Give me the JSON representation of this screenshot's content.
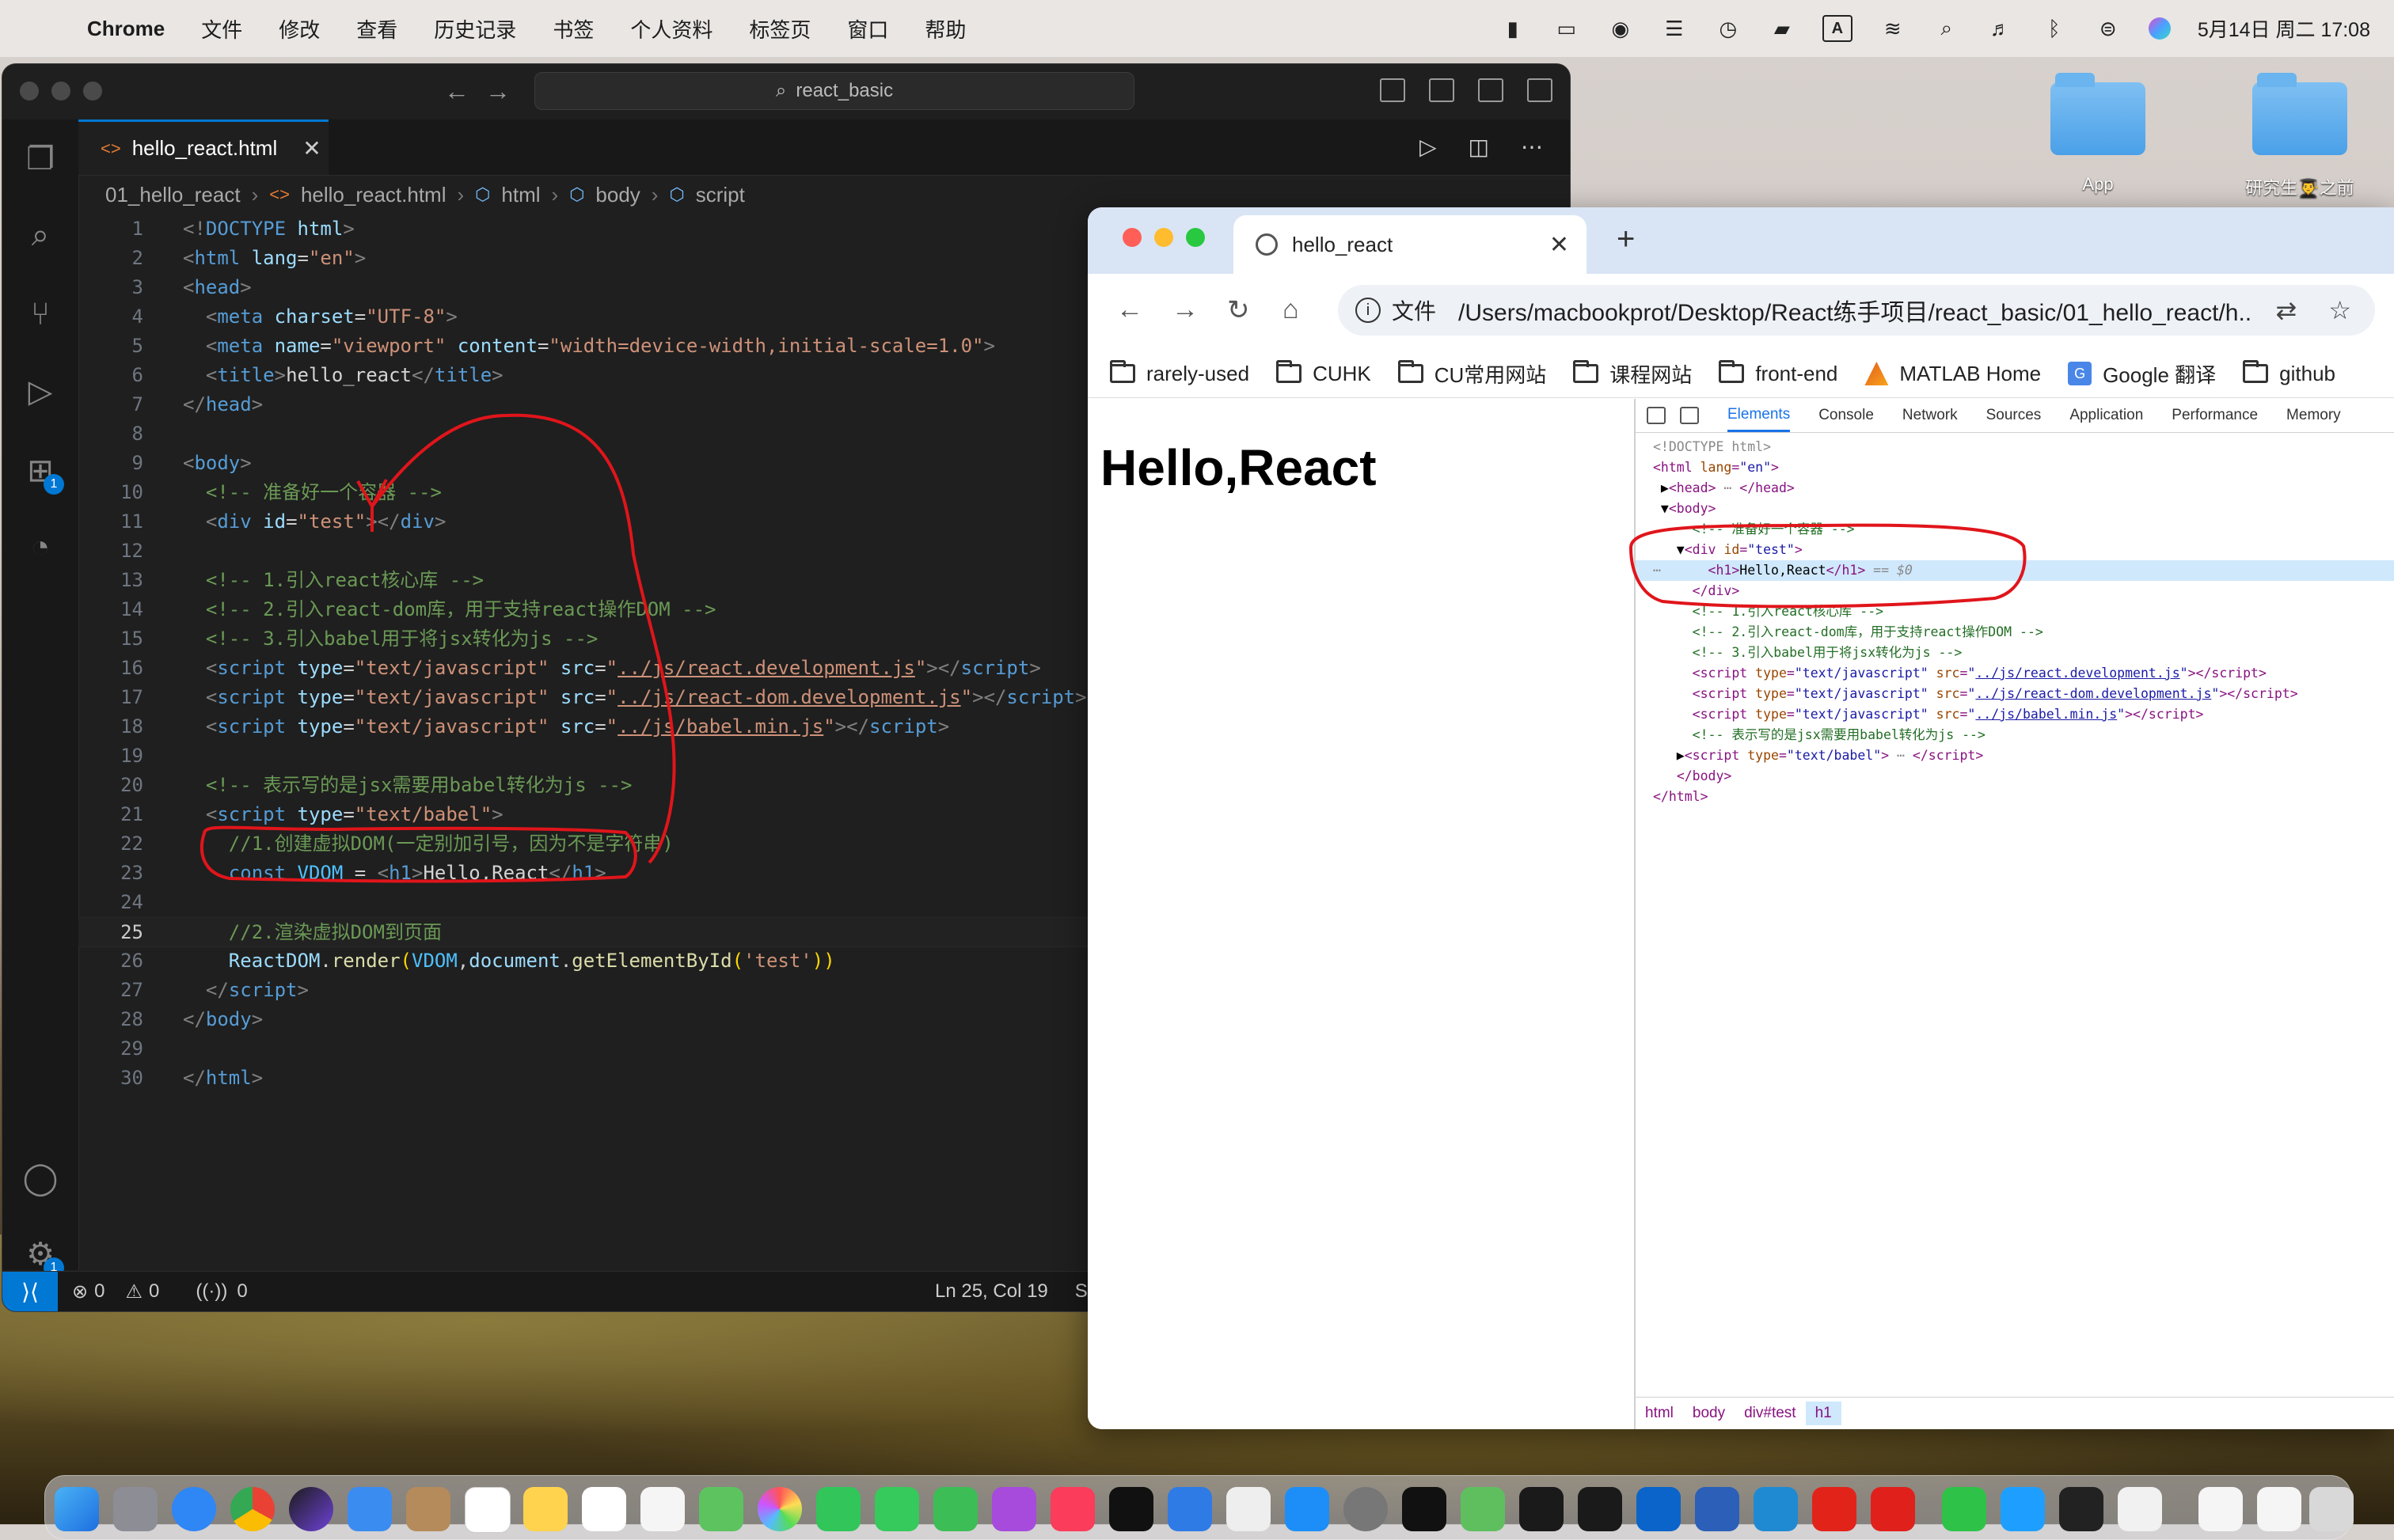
{
  "menubar": {
    "app_name": "Chrome",
    "items": [
      "文件",
      "修改",
      "查看",
      "历史记录",
      "书签",
      "个人资料",
      "标签页",
      "窗口",
      "帮助"
    ],
    "clock": "5月14日 周二  17:08"
  },
  "desktop": {
    "folders": [
      {
        "label": "App"
      },
      {
        "label": "研究生👨‍🎓之前"
      }
    ]
  },
  "vscode": {
    "search": "react_basic",
    "tab_label": "hello_react.html",
    "breadcrumb": [
      "01_hello_react",
      "hello_react.html",
      "html",
      "body",
      "script"
    ],
    "status": {
      "errors": "0",
      "warnings": "0",
      "ports": "0",
      "position": "Ln 25, Col 19",
      "extra": "S"
    },
    "badges": {
      "extensions": "1",
      "settings": "1"
    }
  },
  "code_lines": [
    {
      "n": "1"
    },
    {
      "n": "2"
    },
    {
      "n": "3"
    },
    {
      "n": "4"
    },
    {
      "n": "5"
    },
    {
      "n": "6"
    },
    {
      "n": "7"
    },
    {
      "n": "8"
    },
    {
      "n": "9"
    },
    {
      "n": "10"
    },
    {
      "n": "11"
    },
    {
      "n": "12"
    },
    {
      "n": "13"
    },
    {
      "n": "14"
    },
    {
      "n": "15"
    },
    {
      "n": "16"
    },
    {
      "n": "17"
    },
    {
      "n": "18"
    },
    {
      "n": "19"
    },
    {
      "n": "20"
    },
    {
      "n": "21"
    },
    {
      "n": "22"
    },
    {
      "n": "23"
    },
    {
      "n": "24"
    },
    {
      "n": "25"
    },
    {
      "n": "26"
    },
    {
      "n": "27"
    },
    {
      "n": "28"
    },
    {
      "n": "29"
    },
    {
      "n": "30"
    }
  ],
  "chrome": {
    "tab_title": "hello_react",
    "scheme_label": "文件",
    "url": "/Users/macbookprot/Desktop/React练手项目/react_basic/01_hello_react/h...",
    "bookmarks": [
      "rarely-used",
      "CUHK",
      "CU常用网站",
      "课程网站",
      "front-end",
      "MATLAB Home",
      "Google 翻译",
      "github"
    ],
    "page_heading": "Hello,React",
    "devtools": {
      "tabs": [
        "Elements",
        "Console",
        "Network",
        "Sources",
        "Application",
        "Performance",
        "Memory"
      ],
      "crumbs": [
        "html",
        "body",
        "div#test",
        "h1"
      ]
    }
  },
  "colors": {
    "vscode_bg": "#1f1f1f",
    "accent_blue": "#0078d4",
    "annotation_red": "#e0151b"
  }
}
